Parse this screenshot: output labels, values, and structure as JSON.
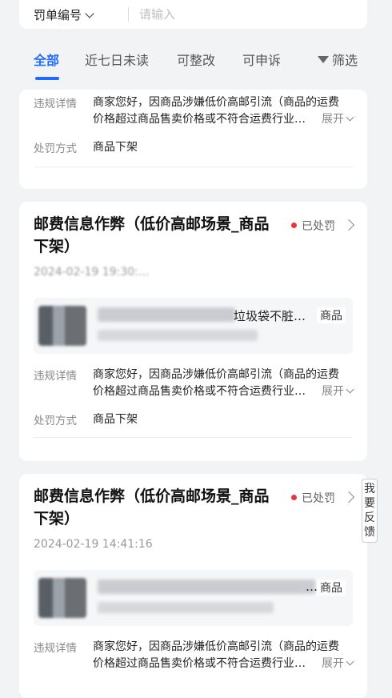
{
  "search": {
    "dropdown_label": "罚单编号",
    "placeholder": "请输入"
  },
  "tabs": [
    {
      "label": "全部"
    },
    {
      "label": "近七日未读"
    },
    {
      "label": "可整改"
    },
    {
      "label": "可申诉"
    }
  ],
  "filter_label": "筛选",
  "labels": {
    "detail": "违规详情",
    "penalty": "处罚方式",
    "expand": "展开"
  },
  "cards": [
    {
      "detail_line1": "商家您好，因商品涉嫌低价高邮引流（商品的运费",
      "detail_line2": "价格超过商品售卖价格或不符合运费行业…",
      "penalty": "商品下架"
    },
    {
      "title": "邮费信息作弊（低价高邮场景_商品下架）",
      "status": "已处罚",
      "time": "2024-02-19 19:30:...",
      "product_name": "垃圾袋不脏…",
      "product_tag": "商品",
      "detail_line1": "商家您好，因商品涉嫌低价高邮引流（商品的运费",
      "detail_line2": "价格超过商品售卖价格或不符合运费行业…",
      "penalty": "商品下架"
    },
    {
      "title": "邮费信息作弊（低价高邮场景_商品下架）",
      "status": "已处罚",
      "time": "2024-02-19 14:41:16",
      "product_name": "…",
      "product_tag": "商品",
      "detail_line1": "商家您好，因商品涉嫌低价高邮引流（商品的运费",
      "detail_line2": "价格超过商品售卖价格或不符合运费行业…"
    }
  ],
  "feedback_label": "我要反馈",
  "colors": {
    "accent": "#1f6bff",
    "status_dot": "#e8343a"
  }
}
